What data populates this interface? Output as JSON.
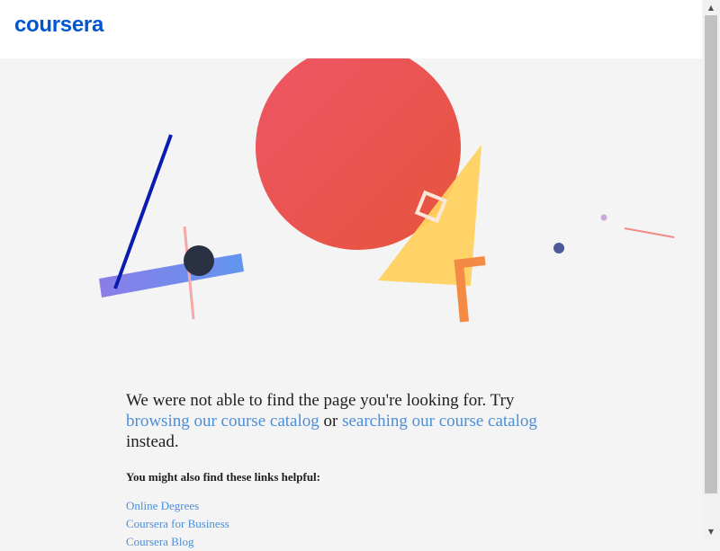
{
  "header": {
    "logo_text": "coursera"
  },
  "message": {
    "part1": "We were not able to find the page you're looking for. Try ",
    "browse_link": "browsing our course catalog",
    "or_text": " or ",
    "search_link": "searching our course catalog",
    "part2": " instead."
  },
  "helpful": {
    "heading": "You might also find these links helpful:",
    "links": [
      "Online Degrees",
      "Coursera for Business",
      "Coursera Blog"
    ]
  },
  "scrollbar": {
    "up_icon": "▲",
    "down_icon": "▼"
  },
  "colors": {
    "brand": "#0056d2",
    "link": "#4a8fdb",
    "circle": "#e9534f",
    "triangle": "#ffd15c",
    "bar": "#7b8cf0"
  }
}
